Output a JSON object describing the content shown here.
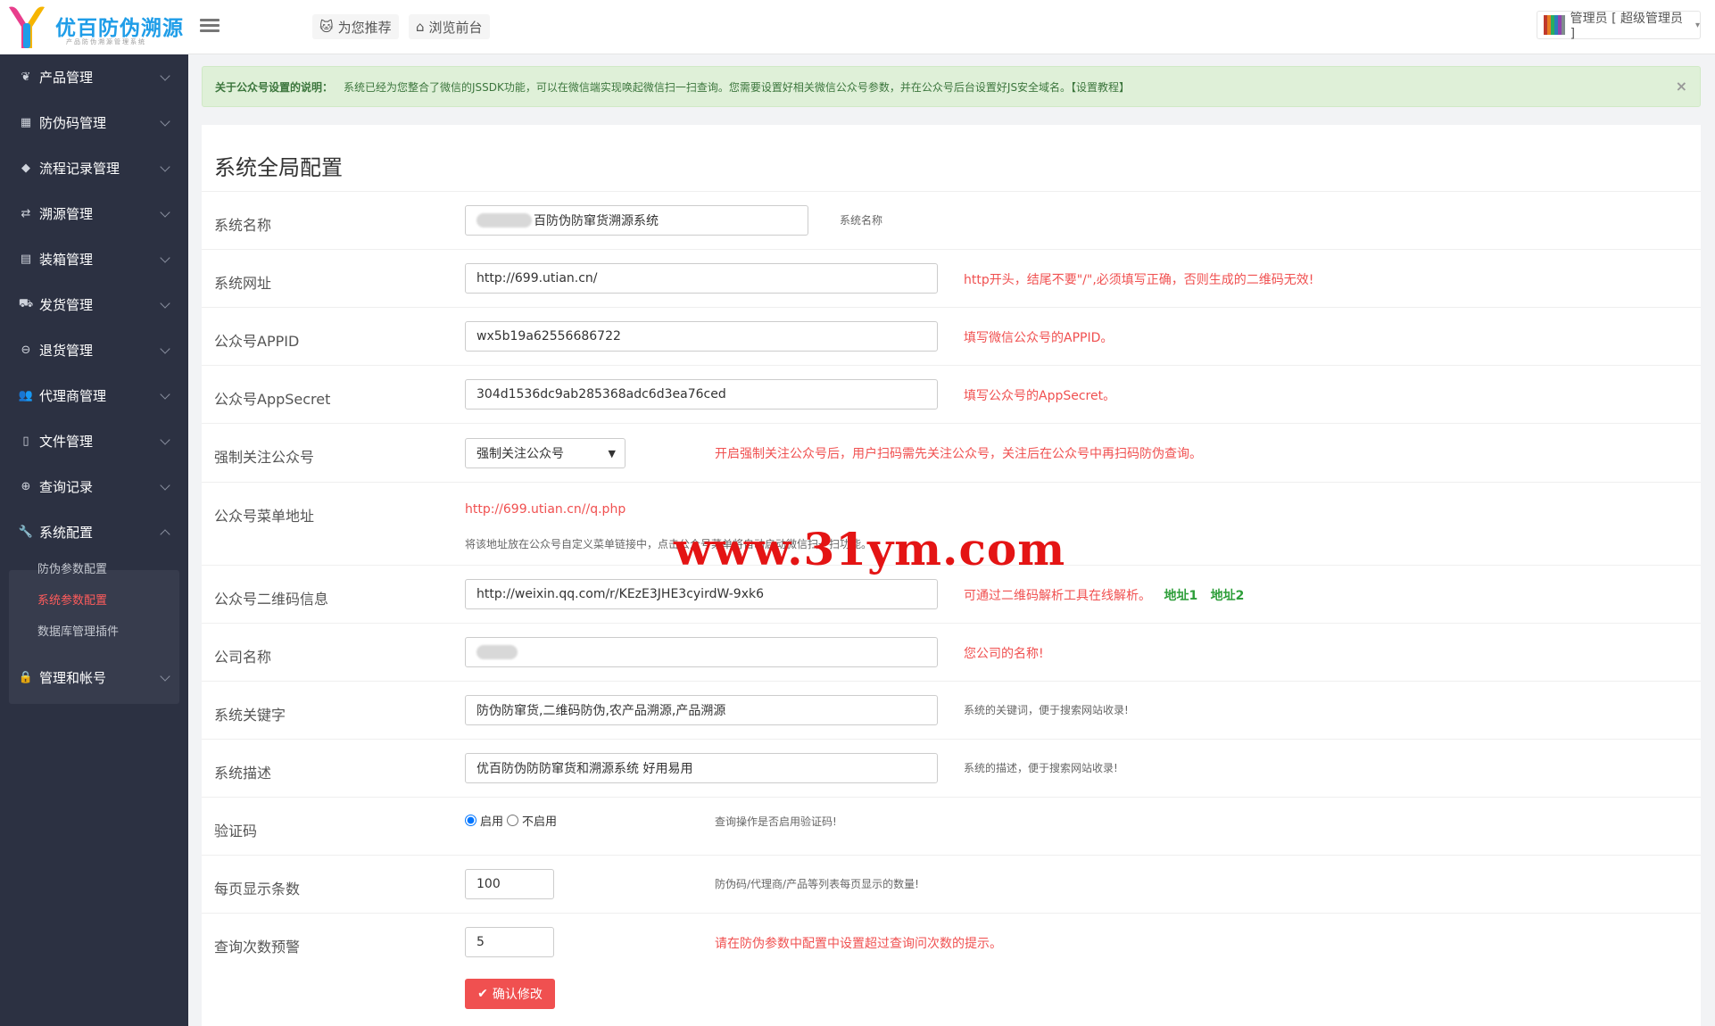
{
  "brand": {
    "title": "优百防伪溯源",
    "subtitle": "产品防伪溯源管理系统",
    "colors": {
      "y_left": "#e83e8c",
      "y_right": "#f6b500",
      "y_stem": "#1f9de8",
      "title": "#1f9de8"
    }
  },
  "topbar": {
    "links": [
      {
        "icon": "github-cat-icon",
        "label": "为您推荐"
      },
      {
        "icon": "home-icon",
        "label": "浏览前台"
      }
    ],
    "user_label": "管理员 [ 超级管理员 ]"
  },
  "sidebar": {
    "items": [
      {
        "icon": "leaf-icon",
        "label": "产品管理"
      },
      {
        "icon": "barcode-icon",
        "label": "防伪码管理"
      },
      {
        "icon": "tags-icon",
        "label": "流程记录管理"
      },
      {
        "icon": "retweet-icon",
        "label": "溯源管理"
      },
      {
        "icon": "grid-icon",
        "label": "装箱管理"
      },
      {
        "icon": "truck-icon",
        "label": "发货管理"
      },
      {
        "icon": "minus-circle-icon",
        "label": "退货管理"
      },
      {
        "icon": "users-icon",
        "label": "代理商管理"
      },
      {
        "icon": "file-icon",
        "label": "文件管理"
      },
      {
        "icon": "search-plus-icon",
        "label": "查询记录"
      },
      {
        "icon": "wrench-icon",
        "label": "系统配置"
      },
      {
        "icon": "lock-icon",
        "label": "管理和帐号"
      }
    ],
    "sub_items": [
      "防伪参数配置",
      "系统参数配置",
      "数据库管理插件"
    ],
    "active_sub": "系统参数配置"
  },
  "alert": {
    "title": "关于公众号设置的说明：",
    "text": "系统已经为您整合了微信的JSSDK功能，可以在微信端实现唤起微信扫一扫查询。您需要设置好相关微信公众号参数，并在公众号后台设置好JS安全域名。【设置教程】",
    "close": "×"
  },
  "panel": {
    "title": "系统全局配置",
    "system_name": {
      "label": "系统名称",
      "value": "百防伪防窜货溯源系统",
      "hint": "系统名称"
    },
    "system_url": {
      "label": "系统网址",
      "value": "http://699.utian.cn/",
      "hint": "http开头，结尾不要\"/\",必须填写正确，否则生成的二维码无效!"
    },
    "appid": {
      "label": "公众号APPID",
      "value": "wx5b19a62556686722",
      "hint": "填写微信公众号的APPID。"
    },
    "appsecret": {
      "label": "公众号AppSecret",
      "value": "304d1536dc9ab285368adc6d3ea76ced",
      "hint": "填写公众号的AppSecret。"
    },
    "force_follow": {
      "label": "强制关注公众号",
      "selected": "强制关注公众号",
      "hint": "开启强制关注公众号后，用户扫码需先关注公众号，关注后在公众号中再扫码防伪查询。"
    },
    "menu_url": {
      "label": "公众号菜单地址",
      "link": "http://699.utian.cn//q.php",
      "hint": "将该地址放在公众号自定义菜单链接中，点击公众号菜单将自动启动微信扫一扫功能。"
    },
    "qrcode": {
      "label": "公众号二维码信息",
      "value": "http://weixin.qq.com/r/KEzE3JHE3cyirdW-9xk6",
      "hint": "可通过二维码解析工具在线解析。",
      "link1": "地址1",
      "link2": "地址2"
    },
    "company": {
      "label": "公司名称",
      "value": "",
      "hint": "您公司的名称!"
    },
    "keywords": {
      "label": "系统关键字",
      "value": "防伪防窜货,二维码防伪,农产品溯源,产品溯源",
      "hint": "系统的关键词，便于搜索网站收录!"
    },
    "description": {
      "label": "系统描述",
      "value": "优百防伪防防窜货和溯源系统 好用易用",
      "hint": "系统的描述，便于搜索网站收录!"
    },
    "captcha": {
      "label": "验证码",
      "on": "启用",
      "off": "不启用",
      "selected": "启用",
      "hint": "查询操作是否启用验证码!"
    },
    "page_size": {
      "label": "每页显示条数",
      "value": "100",
      "hint": "防伪码/代理商/产品等列表每页显示的数量!"
    },
    "query_warn": {
      "label": "查询次数预警",
      "value": "5",
      "hint": "请在防伪参数中配置中设置超过查询问次数的提示。"
    },
    "submit_label": "确认修改"
  },
  "watermark": "www.31ym.com"
}
